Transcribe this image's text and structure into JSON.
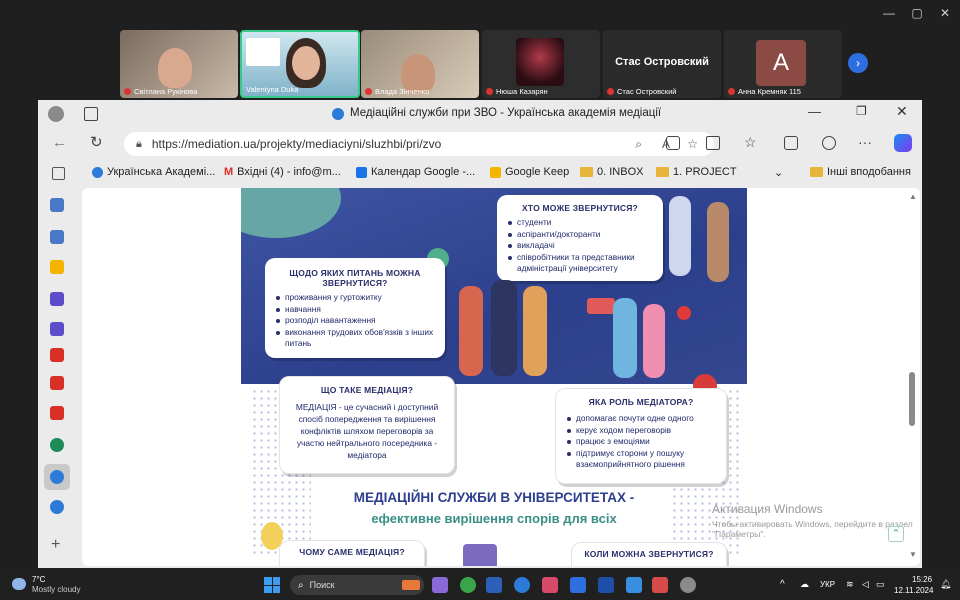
{
  "participants": [
    {
      "name": "Світлана Рукінова",
      "muted": true
    },
    {
      "name": "Valentyna Duka",
      "muted": false
    },
    {
      "name": "Влада Зінченко",
      "muted": true
    },
    {
      "name": "Нюша Казарян",
      "muted": true
    },
    {
      "name": "Стас Островский",
      "muted": true,
      "tile_label": "Стас Островский"
    },
    {
      "name": "Анна Кремняк 115",
      "muted": true,
      "initial": "A"
    }
  ],
  "browser": {
    "tab_title": "Медіаційні служби при ЗВО - Українська академія медіації",
    "url": "https://mediation.ua/projekty/mediaciyni/sluzhbi/pri/zvo",
    "bookmarks": [
      "Українська Академі...",
      "Вхідні (4) - info@m...",
      "Календар Google -...",
      "Google Keep",
      "0. INBOX",
      "1. PROJECT",
      "Інші вподобання"
    ]
  },
  "poster": {
    "who_title": "ХТО МОЖЕ ЗВЕРНУТИСЯ?",
    "who_items": [
      "студенти",
      "аспіранти/докторанти",
      "викладачі",
      "співробітники та представники адміністрації університету"
    ],
    "topics_title": "ЩОДО ЯКИХ ПИТАНЬ  МОЖНА ЗВЕРНУТИСЯ?",
    "topics_items": [
      "проживання у гуртожитку",
      "навчання",
      "розподіл навантаження",
      "виконання трудових обов'язків з інших питань"
    ],
    "what_title": "ЩО ТАКЕ МЕДІАЦІЯ?",
    "what_text": "МЕДІАЦІЯ - це сучасний і доступний спосіб попередження та вирішення конфліктів шляхом переговорів за участю нейтрального посередника - медіатора",
    "role_title": "ЯКА РОЛЬ МЕДІАТОРА?",
    "role_items": [
      "допомагає почути одне одного",
      "керує ходом переговорів",
      "працює з емоціями",
      "підтримує сторони у пошуку взаємоприйнятного рішення"
    ],
    "headline": "МЕДІАЦІЙНІ СЛУЖБИ В УНІВЕРСИТЕТАХ -",
    "subheadline": "ефективне вирішення спорів для всіх",
    "why_title": "ЧОМУ САМЕ МЕДІАЦІЯ?",
    "when_title": "КОЛИ МОЖНА ЗВЕРНУТИСЯ?"
  },
  "watermark": {
    "line1": "Активация Windows",
    "line2": "Чтобы активировать Windows, перейдите в раздел",
    "line3": "\"Параметры\"."
  },
  "taskbar": {
    "weather_temp": "7°C",
    "weather_desc": "Mostly cloudy",
    "search": "Поиск",
    "lang": "УКР",
    "time": "15:26",
    "date": "12.11.2024"
  },
  "colors": {
    "accent": "#2d6fe0",
    "poster_navy": "#2c3f8c",
    "teal": "#3aa6a0"
  }
}
